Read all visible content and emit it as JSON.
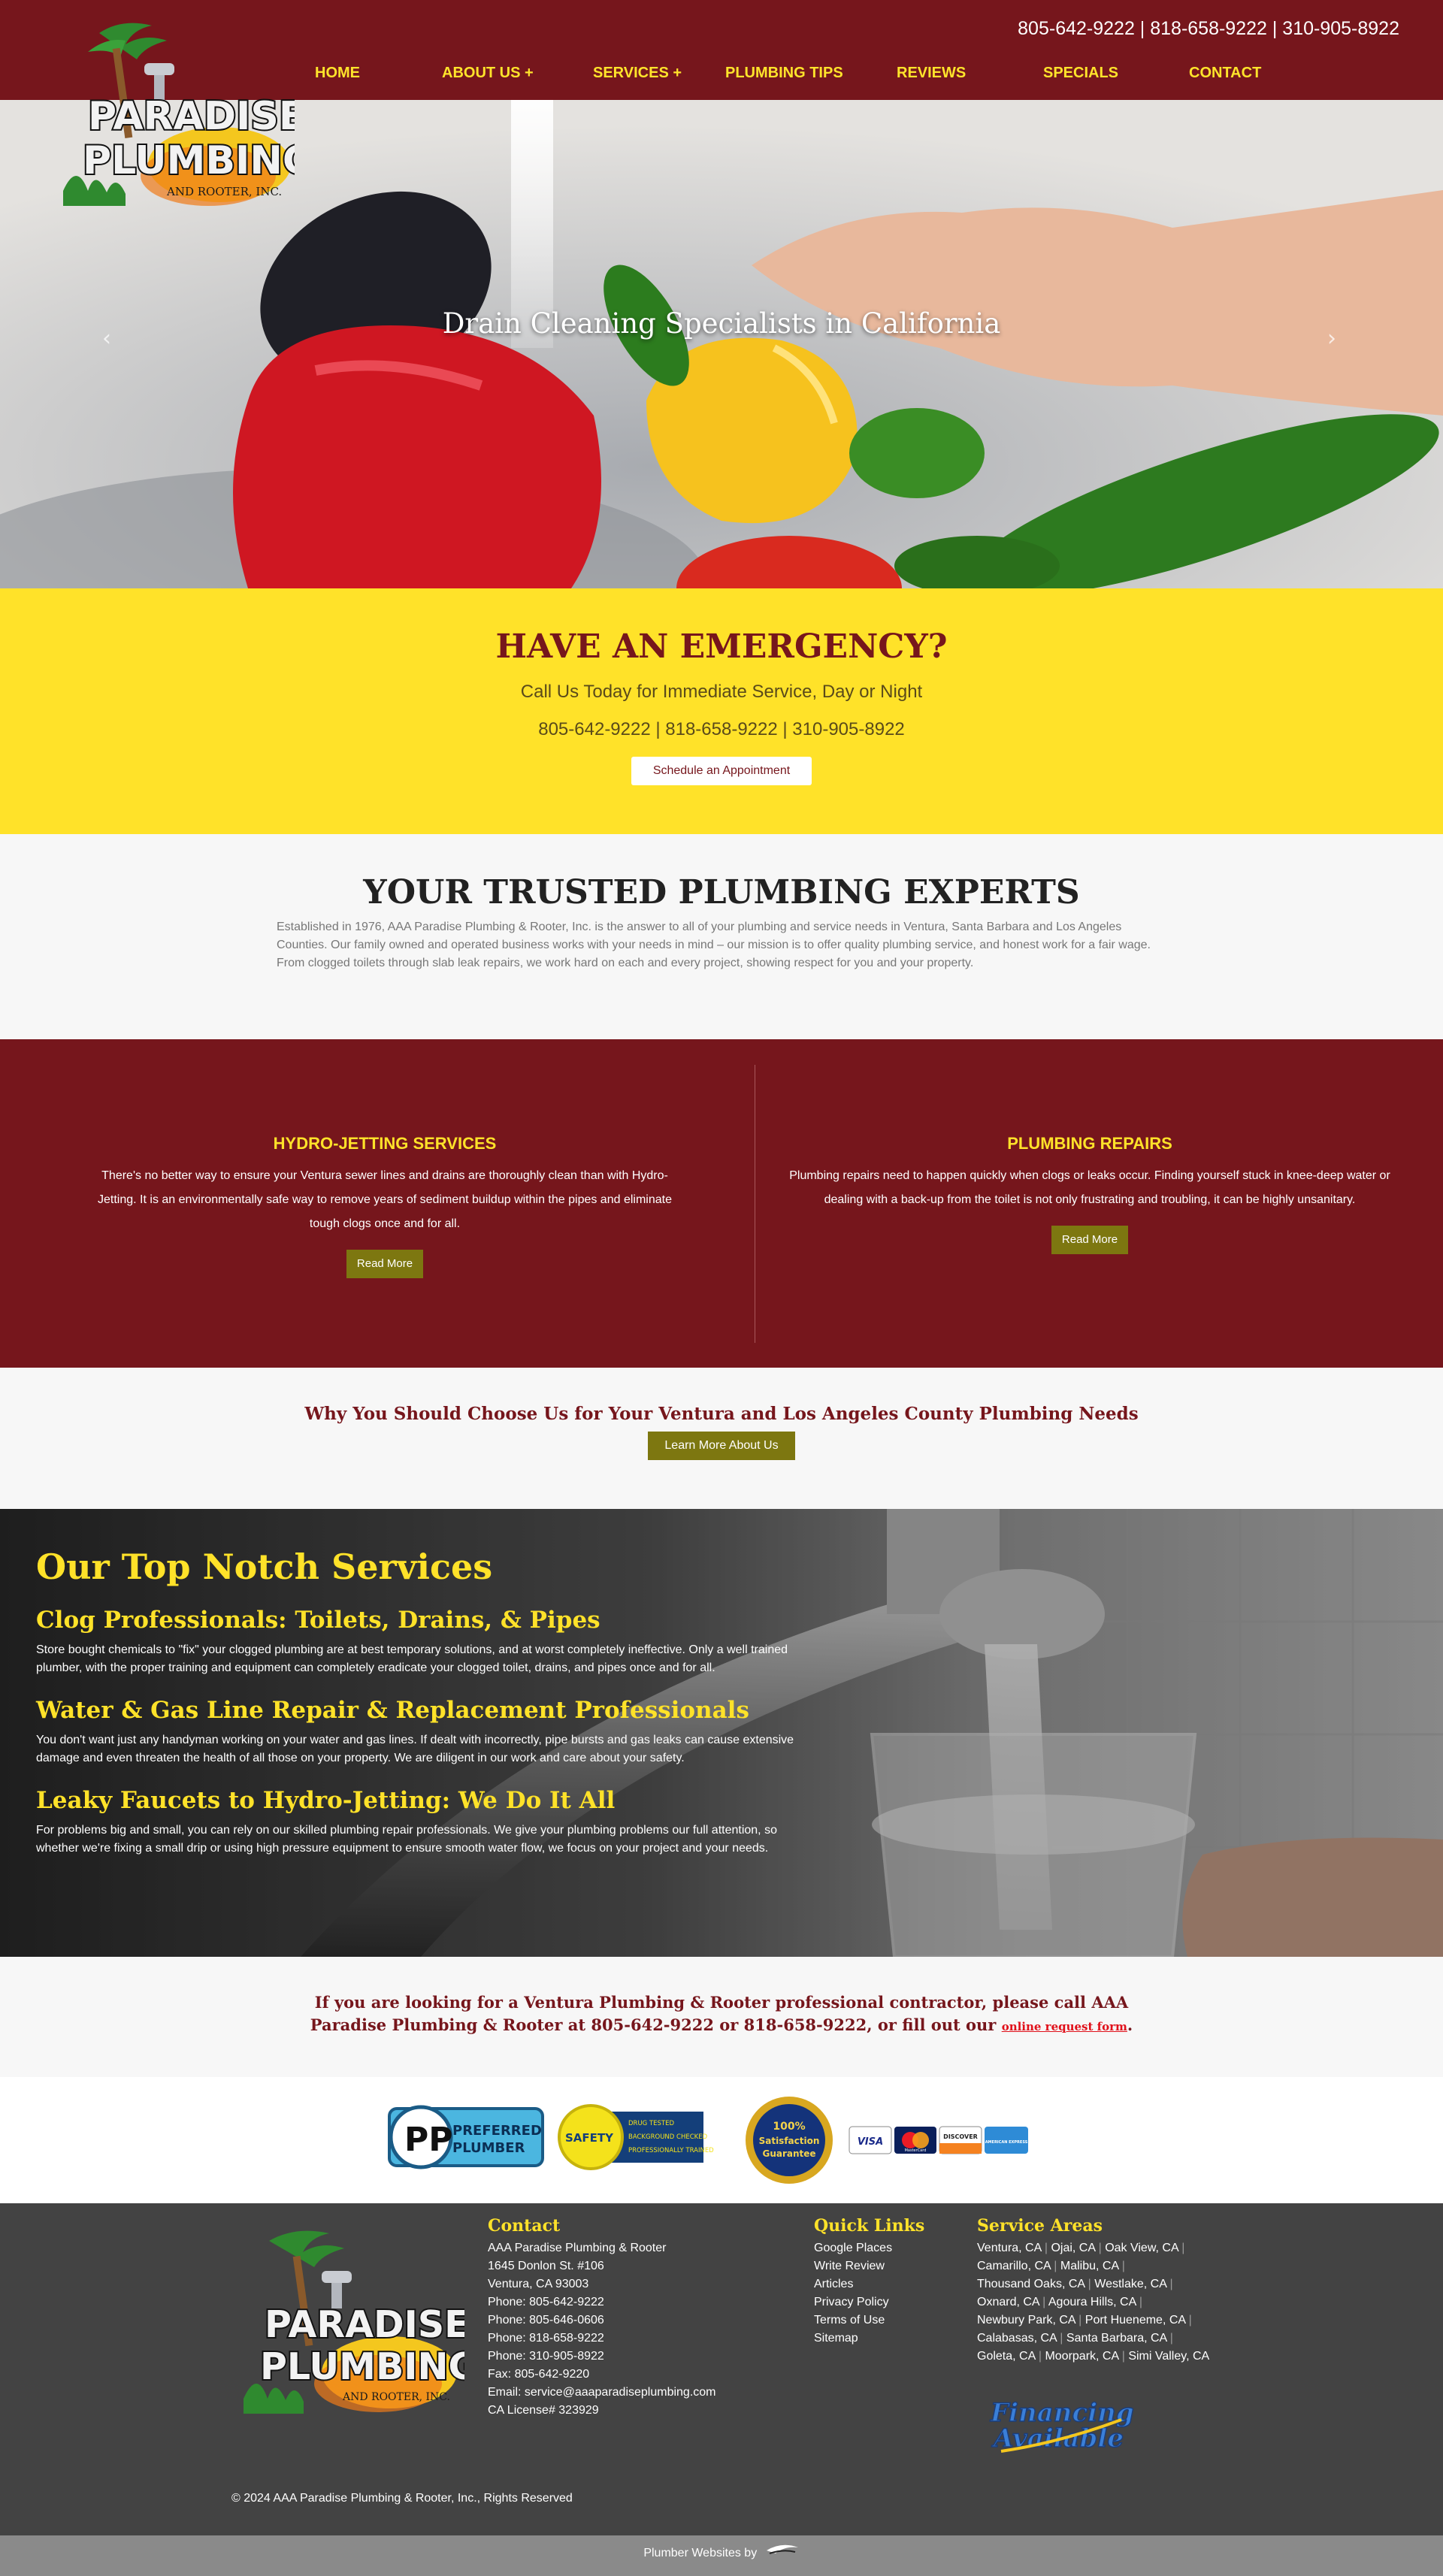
{
  "header": {
    "phones": "805-642-9222 | 818-658-9222 | 310-905-8922",
    "nav": [
      {
        "label": "HOME"
      },
      {
        "label": "ABOUT US +"
      },
      {
        "label": "SERVICES +"
      },
      {
        "label": "PLUMBING TIPS"
      },
      {
        "label": "REVIEWS"
      },
      {
        "label": "SPECIALS"
      },
      {
        "label": "CONTACT"
      }
    ]
  },
  "logo": {
    "line1": "PARADISE",
    "line2": "PLUMBING",
    "tagline": "AND ROOTER, INC."
  },
  "hero": {
    "caption": "Drain Cleaning Specialists in California"
  },
  "emergency": {
    "title": "HAVE AN EMERGENCY?",
    "subtitle": "Call Us Today for Immediate Service, Day or Night",
    "phones": "805-642-9222 | 818-658-9222 | 310-905-8922",
    "button": "Schedule an Appointment"
  },
  "trusted": {
    "title": "YOUR TRUSTED PLUMBING EXPERTS",
    "body": "Established in 1976, AAA Paradise Plumbing & Rooter, Inc. is the answer to all of your plumbing and service needs in Ventura, Santa Barbara and Los Angeles Counties. Our family owned and operated business works with your needs in mind – our mission is to offer quality plumbing service, and honest work for a fair wage. From clogged toilets through slab leak repairs, we work hard on each and every project, showing respect for you and your property."
  },
  "columns": [
    {
      "title": "HYDRO-JETTING SERVICES",
      "body": "There's no better way to ensure your Ventura sewer lines and drains are thoroughly clean than with Hydro-Jetting. It is an environmentally safe way to remove years of sediment buildup within the pipes and eliminate tough clogs once and for all.",
      "button": "Read More"
    },
    {
      "title": "PLUMBING REPAIRS",
      "body": "Plumbing repairs need to happen quickly when clogs or leaks occur. Finding yourself stuck in knee-deep water or dealing with a back-up from the toilet is not only frustrating and troubling, it can be highly unsanitary.",
      "button": "Read More"
    }
  ],
  "why": {
    "title": "Why You Should Choose Us for Your Ventura and Los Angeles County Plumbing Needs",
    "button": "Learn More About Us"
  },
  "notch": {
    "title": "Our Top Notch Services",
    "items": [
      {
        "heading": "Clog Professionals: Toilets, Drains, & Pipes",
        "body": "Store bought chemicals to \"fix\" your clogged plumbing are at best temporary solutions, and at worst completely ineffective. Only a well trained plumber, with the proper training and equipment can completely eradicate your clogged toilet, drains, and pipes once and for all."
      },
      {
        "heading": "Water & Gas Line Repair & Replacement Professionals",
        "body": "You don't want just any handyman working on your water and gas lines. If dealt with incorrectly, pipe bursts and gas leaks can cause extensive damage and even threaten the health of all those on your property. We are diligent in our work and care about your safety."
      },
      {
        "heading": "Leaky Faucets to Hydro-Jetting: We Do It All",
        "body": "For problems big and small, you can rely on our skilled plumbing repair professionals. We give your plumbing problems our full attention, so whether we're fixing a small drip or using high pressure equipment to ensure smooth water flow, we focus on your project and your needs."
      }
    ]
  },
  "cta": {
    "text": "If you are looking for a Ventura Plumbing & Rooter professional contractor, please call AAA Paradise Plumbing & Rooter at 805-642-9222 or 818-658-9222, or fill out our ",
    "link": "online request form",
    "end": "."
  },
  "badges": {
    "preferred": {
      "line1": "PREFERRED",
      "line2": "PLUMBER"
    },
    "safety": {
      "label": "SAFETY",
      "lines": [
        "DRUG TESTED",
        "BACKGROUND CHECKED",
        "PROFESSIONALLY TRAINED"
      ]
    },
    "guarantee": {
      "line1": "100%",
      "line2": "Satisfaction",
      "line3": "Guarantee"
    },
    "cards": [
      "VISA",
      "MasterCard",
      "DISCOVER",
      "AMERICAN EXPRESS"
    ]
  },
  "footer": {
    "contact": {
      "title": "Contact",
      "lines": [
        "AAA Paradise Plumbing & Rooter",
        "1645 Donlon St. #106",
        "Ventura, CA 93003",
        "Phone: 805-642-9222",
        "Phone: 805-646-0606",
        "Phone: 818-658-9222",
        "Phone: 310-905-8922",
        "Fax: 805-642-9220",
        "Email: service@aaaparadiseplumbing.com",
        "CA License# 323929"
      ]
    },
    "quick_links": {
      "title": "Quick Links",
      "items": [
        "Google Places",
        "Write Review",
        "Articles",
        "Privacy Policy",
        "Terms of Use",
        "Sitemap"
      ]
    },
    "service_areas": {
      "title": "Service Areas",
      "items": [
        "Ventura, CA",
        "Ojai, CA",
        "Oak View, CA",
        "Camarillo, CA",
        "Malibu, CA",
        "Thousand Oaks, CA",
        "Westlake, CA",
        "Oxnard, CA",
        "Agoura Hills, CA",
        "Newbury Park, CA",
        "Port Hueneme, CA",
        "Calabasas, CA",
        "Santa Barbara, CA",
        "Goleta, CA",
        "Moorpark, CA",
        "Simi Valley, CA"
      ]
    },
    "financing": {
      "line1": "Financing",
      "line2": "Available"
    },
    "copyright": "© 2024 AAA Paradise Plumbing & Rooter, Inc., Rights Reserved",
    "credit": "Plumber Websites by"
  }
}
